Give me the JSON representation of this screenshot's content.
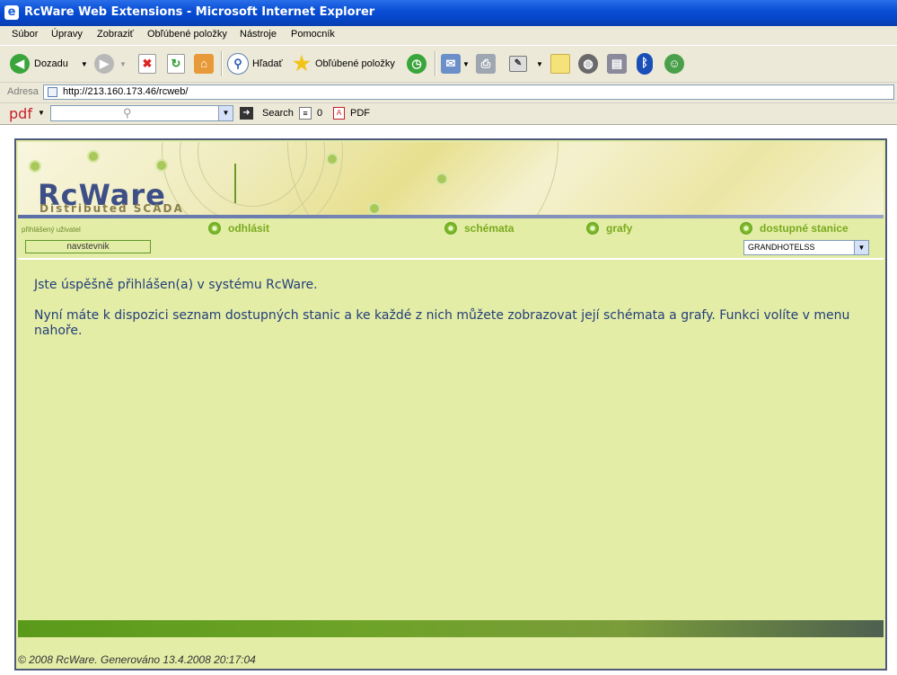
{
  "window": {
    "title": "RcWare Web Extensions - Microsoft Internet Explorer"
  },
  "menu": [
    "Súbor",
    "Úpravy",
    "Zobraziť",
    "Obľúbené položky",
    "Nástroje",
    "Pomocník"
  ],
  "toolbar": {
    "back_label": "Dozadu",
    "search_label": "Hľadať",
    "favorites_label": "Obľúbené položky"
  },
  "address": {
    "label": "Adresa",
    "url": "http://213.160.173.46/rcweb/"
  },
  "pdf_toolbar": {
    "logo": "pdf",
    "search_label": "Search",
    "count": "0",
    "pdf_label": "PDF"
  },
  "page": {
    "logo_text": "RcWare",
    "logo_subtitle": "Distributed SCADA",
    "user_label": "přihlášený uživatel",
    "user_name": "navstevnik",
    "nav": {
      "logout": "odhlásit",
      "schemas": "schémata",
      "charts": "grafy",
      "stations": "dostupné stanice"
    },
    "selected_station": "GRANDHOTELSS",
    "message_line1": "Jste úspěšně přihlášen(a) v systému RcWare.",
    "message_line2": "Nyní máte k dispozici seznam dostupných stanic a ke každé z nich můžete zobrazovat její schémata a grafy. Funkci volíte v menu nahoře.",
    "footer": "© 2008 RcWare. Generováno 13.4.2008 20:17:04"
  },
  "colors": {
    "title_bar": "#0a4fd6",
    "chrome": "#ece9d8",
    "page_bg": "#e3eda6",
    "nav_text": "#7aaa1e",
    "message_text": "#243d7a"
  }
}
